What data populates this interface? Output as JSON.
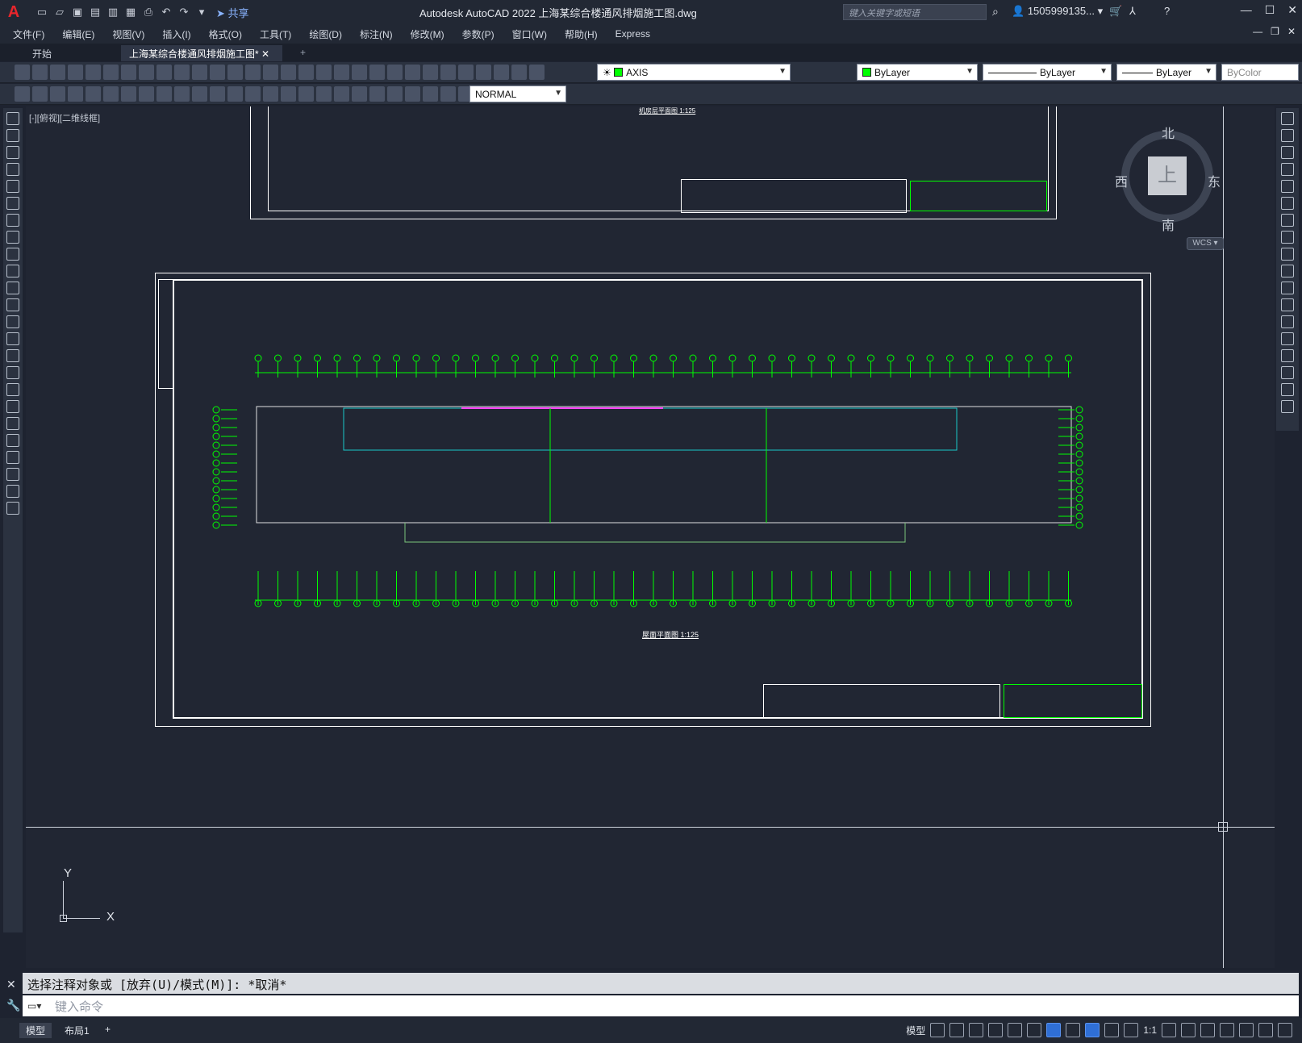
{
  "titlebar": {
    "logo": "A",
    "share": "共享",
    "app_title": "Autodesk AutoCAD 2022    上海某综合楼通风排烟施工图.dwg",
    "search_placeholder": "键入关键字或短语",
    "user": "1505999135..."
  },
  "menu": [
    "文件(F)",
    "编辑(E)",
    "视图(V)",
    "插入(I)",
    "格式(O)",
    "工具(T)",
    "绘图(D)",
    "标注(N)",
    "修改(M)",
    "参数(P)",
    "窗口(W)",
    "帮助(H)",
    "Express"
  ],
  "tabs": {
    "start": "开始",
    "doc": "上海某综合楼通风排烟施工图*",
    "add": "+"
  },
  "toolbar": {
    "layer": "AXIS",
    "color": "ByLayer",
    "linetype": "ByLayer",
    "lineweight": "ByLayer",
    "plotstyle": "ByColor",
    "textstyle": "NORMAL"
  },
  "viewport": {
    "label": "[-][俯视][二维线框]",
    "compass": {
      "north": "北",
      "south": "南",
      "east": "东",
      "west": "西",
      "top": "上"
    },
    "wcs": "WCS",
    "ucs_x": "X",
    "ucs_y": "Y"
  },
  "drawing": {
    "title_top": "机房层平面图 1:125",
    "title_main": "屋面平面图 1:125"
  },
  "command": {
    "history": "选择注释对象或 [放弃(U)/模式(M)]: *取消*",
    "placeholder": "键入命令"
  },
  "status": {
    "model_tab": "模型",
    "layout_tab": "布局1",
    "add": "+",
    "model_btn": "模型",
    "scale": "1:1"
  },
  "colors": {
    "accent_green": "#00ff00",
    "background": "#212633",
    "logo_red": "#e8262c"
  }
}
